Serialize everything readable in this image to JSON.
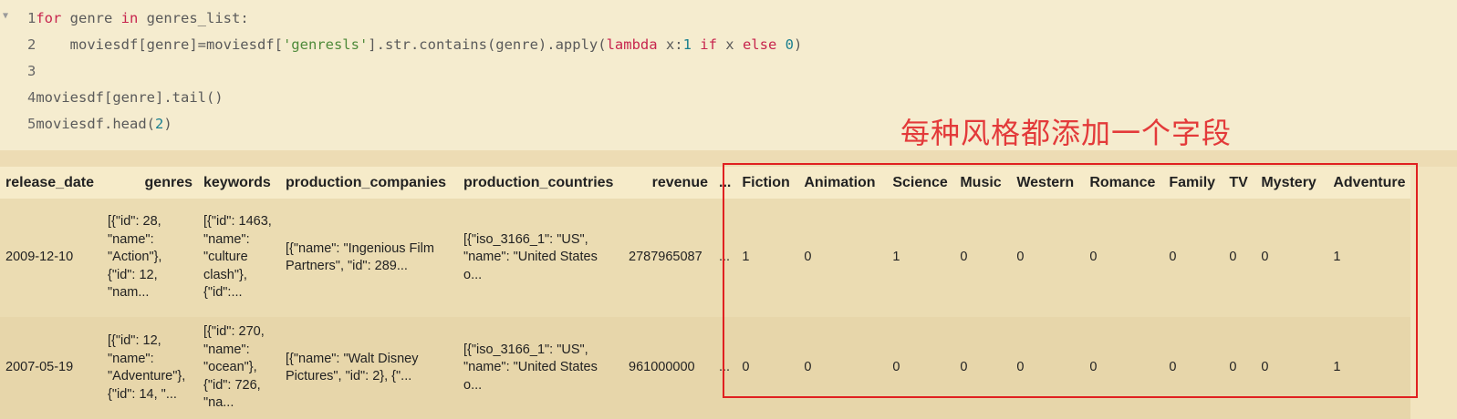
{
  "code": {
    "lines": [
      {
        "n": "1",
        "tokens": [
          [
            "kw",
            "for"
          ],
          [
            "t",
            " genre "
          ],
          [
            "kw",
            "in"
          ],
          [
            "t",
            " genres_list:"
          ]
        ]
      },
      {
        "n": "2",
        "tokens": [
          [
            "t",
            "    moviesdf[genre]=moviesdf["
          ],
          [
            "str",
            "'genresls'"
          ],
          [
            "t",
            "].str.contains(genre).apply("
          ],
          [
            "kw",
            "lambda"
          ],
          [
            "t",
            " x:"
          ],
          [
            "num",
            "1"
          ],
          [
            "t",
            " "
          ],
          [
            "kw",
            "if"
          ],
          [
            "t",
            " x "
          ],
          [
            "kw",
            "else"
          ],
          [
            "t",
            " "
          ],
          [
            "num",
            "0"
          ],
          [
            "t",
            ")"
          ]
        ]
      },
      {
        "n": "3",
        "tokens": []
      },
      {
        "n": "4",
        "tokens": [
          [
            "t",
            "moviesdf[genre].tail()"
          ]
        ]
      },
      {
        "n": "5",
        "tokens": [
          [
            "t",
            "moviesdf.head("
          ],
          [
            "num",
            "2"
          ],
          [
            "t",
            ")"
          ]
        ]
      }
    ]
  },
  "annotation": {
    "text": "每种风格都添加一个字段",
    "color": "#e33a3a"
  },
  "table": {
    "columns": [
      "release_date",
      "genres",
      "keywords",
      "production_companies",
      "production_countries",
      "revenue",
      "...",
      "Fiction",
      "Animation",
      "Science",
      "Music",
      "Western",
      "Romance",
      "Family",
      "TV",
      "Mystery",
      "Adventure"
    ],
    "rows": [
      [
        "2009-12-10",
        "[{\"id\": 28, \"name\": \"Action\"}, {\"id\": 12, \"nam...",
        "[{\"id\": 1463, \"name\": \"culture clash\"}, {\"id\":...",
        "[{\"name\": \"Ingenious Film Partners\", \"id\": 289...",
        "[{\"iso_3166_1\": \"US\", \"name\": \"United States o...",
        "2787965087",
        "...",
        "1",
        "0",
        "1",
        "0",
        "0",
        "0",
        "0",
        "0",
        "0",
        "1"
      ],
      [
        "2007-05-19",
        "[{\"id\": 12, \"name\": \"Adventure\"}, {\"id\": 14, \"...",
        "[{\"id\": 270, \"name\": \"ocean\"}, {\"id\": 726, \"na...",
        "[{\"name\": \"Walt Disney Pictures\", \"id\": 2}, {\"...",
        "[{\"iso_3166_1\": \"US\", \"name\": \"United States o...",
        "961000000",
        "...",
        "0",
        "0",
        "0",
        "0",
        "0",
        "0",
        "0",
        "0",
        "0",
        "1"
      ]
    ]
  },
  "colors": {
    "highlight_box": "#e02020",
    "keyword": "#c7254e",
    "string": "#4e8a3a",
    "number": "#1a7f8f"
  }
}
